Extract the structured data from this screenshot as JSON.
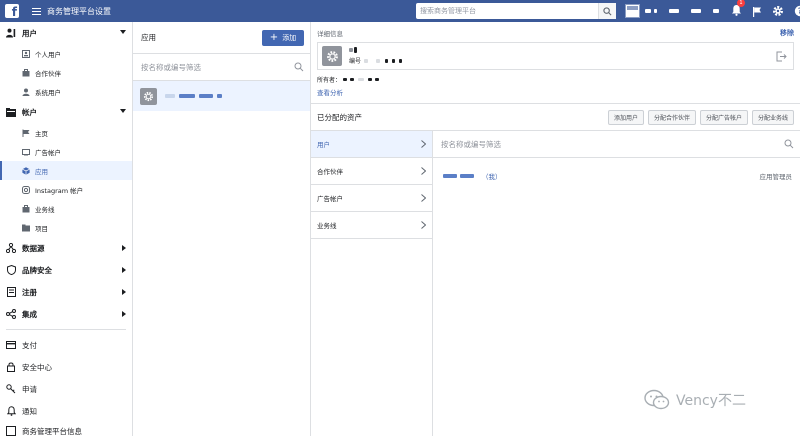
{
  "topbar": {
    "title": "商务管理平台设置",
    "search_placeholder": "搜索商务管理平台",
    "notification_count": "1"
  },
  "sidebar": {
    "sections": [
      {
        "label": "用户",
        "icon": "people-icon",
        "items": [
          {
            "label": "个人用户",
            "icon": "person-card-icon"
          },
          {
            "label": "合作伙伴",
            "icon": "briefcase-icon"
          },
          {
            "label": "系统用户",
            "icon": "system-user-icon"
          }
        ]
      },
      {
        "label": "帐户",
        "icon": "folder-icon",
        "items": [
          {
            "label": "主页",
            "icon": "flag-icon"
          },
          {
            "label": "广告帐户",
            "icon": "ad-account-icon"
          },
          {
            "label": "应用",
            "icon": "cube-icon"
          },
          {
            "label": "Instagram 帐户",
            "icon": "instagram-icon"
          },
          {
            "label": "业务线",
            "icon": "business-line-icon"
          },
          {
            "label": "项目",
            "icon": "project-icon"
          }
        ]
      }
    ],
    "collapsed": [
      {
        "label": "数据源",
        "icon": "data-source-icon"
      },
      {
        "label": "品牌安全",
        "icon": "shield-icon"
      },
      {
        "label": "注册",
        "icon": "register-icon"
      },
      {
        "label": "集成",
        "icon": "integration-icon"
      }
    ],
    "bottom": [
      {
        "label": "支付",
        "icon": "payment-icon"
      },
      {
        "label": "安全中心",
        "icon": "lock-icon"
      },
      {
        "label": "申请",
        "icon": "key-icon"
      },
      {
        "label": "通知",
        "icon": "bell-icon"
      },
      {
        "label": "商务管理平台信息",
        "icon": "info-icon"
      }
    ]
  },
  "applist": {
    "title": "应用",
    "add_label": "添加",
    "filter_placeholder": "按名称或编号筛选"
  },
  "detail": {
    "section_label": "详细信息",
    "remove_label": "移除",
    "id_label": "编号",
    "owner_label": "所有者",
    "analysis_label": "查看分析",
    "assets_title": "已分配的资产",
    "asset_buttons": [
      "添加用户",
      "分配合作伙伴",
      "分配广告帐户",
      "分配业务线"
    ],
    "categories": [
      "用户",
      "合作伙伴",
      "广告帐户",
      "业务线"
    ],
    "user_filter_placeholder": "按名称或编号筛选",
    "user_me": "（我）",
    "user_role": "应用管理员"
  },
  "watermark": {
    "text": "Vency不二"
  },
  "colors": {
    "brand": "#3b5998",
    "accent": "#4267b2",
    "active_bg": "#ecf3ff"
  }
}
